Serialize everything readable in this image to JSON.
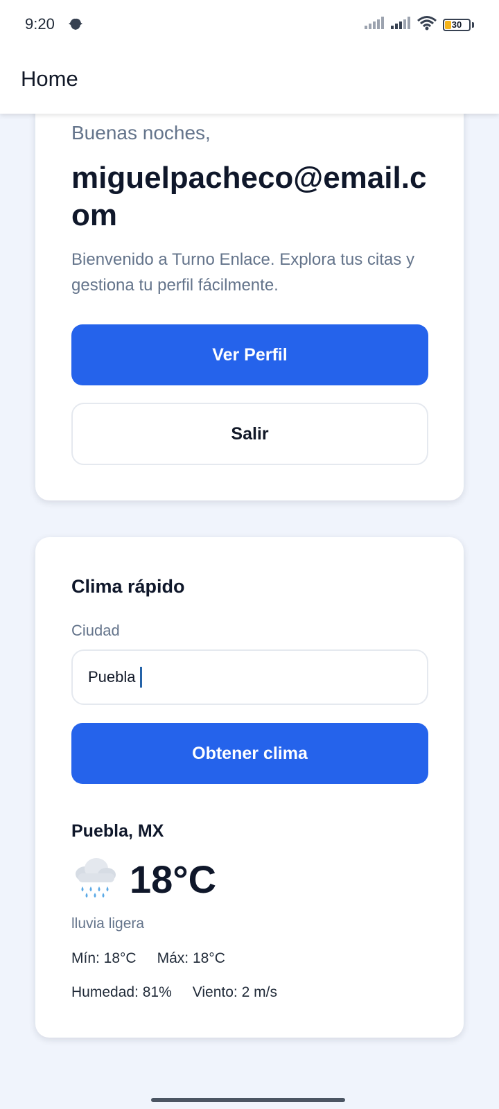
{
  "status_bar": {
    "time": "9:20",
    "battery_level": "30",
    "icons": [
      "notification-icon",
      "signal-icon",
      "signal-icon",
      "wifi-icon",
      "battery-icon"
    ]
  },
  "app_bar": {
    "title": "Home"
  },
  "profile_card": {
    "greeting": "Buenas noches,",
    "email": "miguelpacheco@email.com",
    "welcome": "Bienvenido a Turno Enlace. Explora tus citas y gestiona tu perfil fácilmente.",
    "view_profile_label": "Ver Perfil",
    "logout_label": "Salir"
  },
  "weather_card": {
    "title": "Clima rápido",
    "city_label": "Ciudad",
    "city_value": "Puebla",
    "button_label": "Obtener clima",
    "location": "Puebla, MX",
    "icon": "rain-cloud-icon",
    "temperature": "18°C",
    "description": "lluvia ligera",
    "min": "Mín: 18°C",
    "max": "Máx: 18°C",
    "humidity": "Humedad: 81%",
    "wind": "Viento: 2 m/s"
  },
  "colors": {
    "accent": "#2563eb",
    "background": "#f0f4fc",
    "muted_text": "#64748b",
    "battery": "#f5b41a"
  }
}
